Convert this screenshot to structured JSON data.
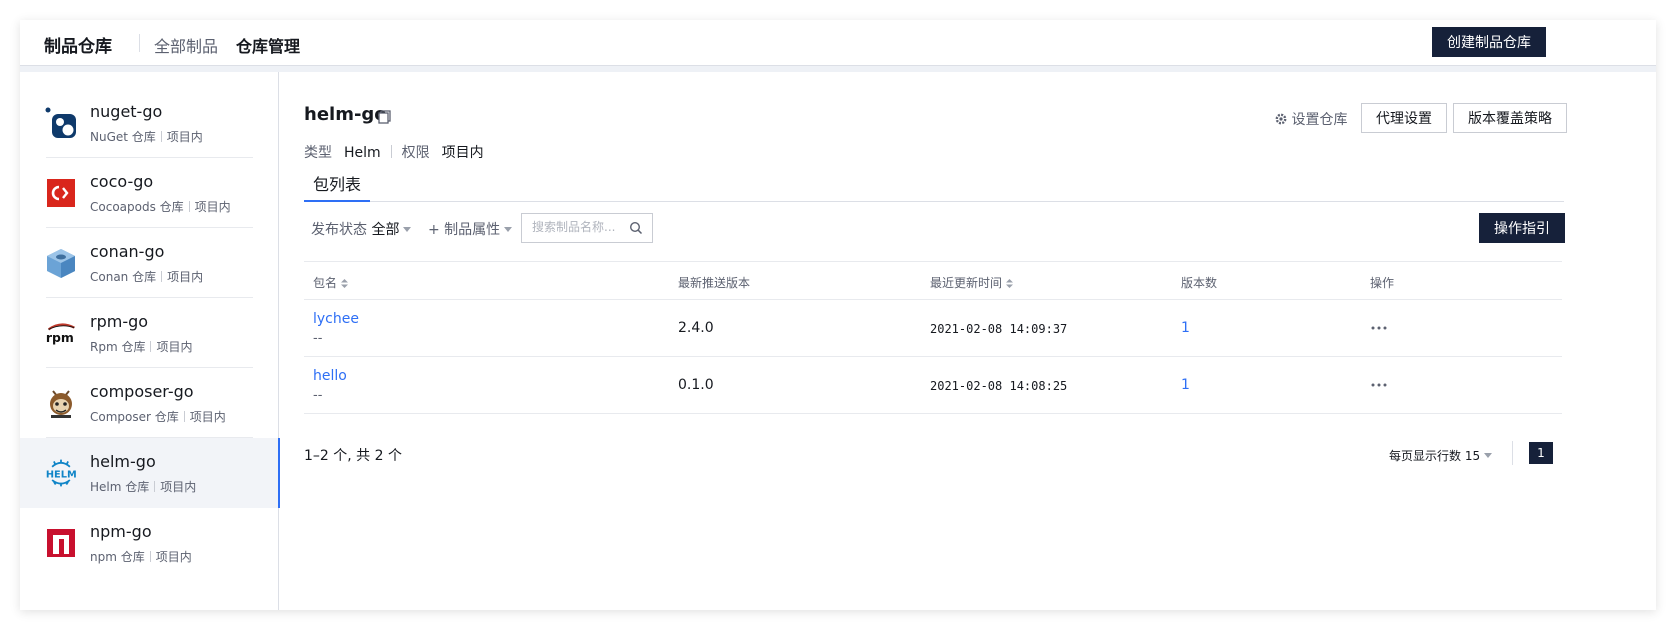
{
  "header": {
    "brand": "制品仓库",
    "tabs": [
      {
        "label": "全部制品"
      },
      {
        "label": "仓库管理"
      }
    ],
    "create_button": "创建制品仓库"
  },
  "sidebar": {
    "items": [
      {
        "name": "nuget-go",
        "type": "NuGet 仓库",
        "scope": "项目内",
        "icon": "nuget-icon"
      },
      {
        "name": "coco-go",
        "type": "Cocoapods 仓库",
        "scope": "项目内",
        "icon": "cocoapods-icon"
      },
      {
        "name": "conan-go",
        "type": "Conan 仓库",
        "scope": "项目内",
        "icon": "conan-icon"
      },
      {
        "name": "rpm-go",
        "type": "Rpm 仓库",
        "scope": "项目内",
        "icon": "rpm-icon"
      },
      {
        "name": "composer-go",
        "type": "Composer 仓库",
        "scope": "项目内",
        "icon": "composer-icon"
      },
      {
        "name": "helm-go",
        "type": "Helm 仓库",
        "scope": "项目内",
        "icon": "helm-icon",
        "selected": true
      },
      {
        "name": "npm-go",
        "type": "npm 仓库",
        "scope": "项目内",
        "icon": "npm-icon"
      }
    ]
  },
  "repo": {
    "title": "helm-go",
    "type_label": "类型",
    "type_value": "Helm",
    "perm_label": "权限",
    "perm_value": "项目内",
    "settings_link": "设置仓库",
    "proxy_button": "代理设置",
    "override_button": "版本覆盖策略"
  },
  "subtabs": [
    {
      "label": "包列表"
    }
  ],
  "filters": {
    "status_label": "发布状态",
    "status_value": "全部",
    "attr_label": "+ 制品属性",
    "search_placeholder": "搜索制品名称...",
    "guide_button": "操作指引"
  },
  "table": {
    "columns": [
      "包名",
      "最新推送版本",
      "最近更新时间",
      "版本数",
      "操作"
    ],
    "rows": [
      {
        "name": "lychee",
        "desc": "--",
        "version": "2.4.0",
        "updated": "2021-02-08 14:09:37",
        "count": "1"
      },
      {
        "name": "hello",
        "desc": "--",
        "version": "0.1.0",
        "updated": "2021-02-08 14:08:25",
        "count": "1"
      }
    ]
  },
  "pagination": {
    "summary": "1–2 个, 共 2 个",
    "page_size_label": "每页显示行数 15",
    "current_page": "1"
  },
  "colors": {
    "accent": "#2e6ff5",
    "dark_button": "#16213a"
  }
}
